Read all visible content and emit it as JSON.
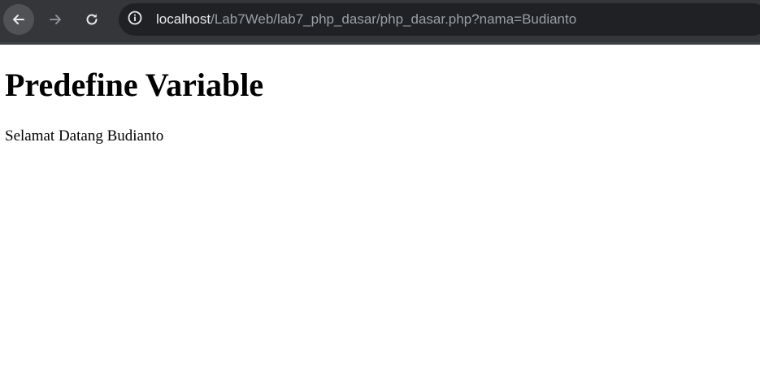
{
  "browser": {
    "address_bar": {
      "host": "localhost",
      "path": "/Lab7Web/lab7_php_dasar/php_dasar.php?nama=Budianto"
    },
    "icons": {
      "back": "arrow-left-icon",
      "forward": "arrow-right-icon",
      "reload": "reload-icon",
      "site_info": "info-circle-icon"
    },
    "colors": {
      "toolbar": "#35363a",
      "omnibox": "#202124",
      "host_text": "#e8eaed",
      "path_text": "#9aa0a6"
    }
  },
  "page": {
    "heading": "Predefine Variable",
    "welcome": "Selamat Datang Budianto"
  }
}
